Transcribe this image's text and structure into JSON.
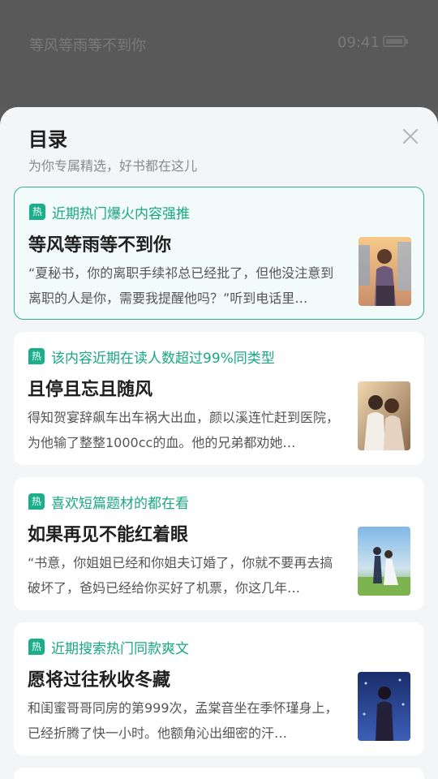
{
  "status": {
    "book_title": "等风等雨等不到你",
    "time": "09:41"
  },
  "sheet": {
    "title": "目录",
    "subtitle": "为你专属精选，好书都在这儿"
  },
  "hot_badge": "热",
  "books": [
    {
      "tag": "近期热门爆火内容强推",
      "title": "等风等雨等不到你",
      "desc": "“夏秘书，你的离职手续祁总已经批了，但他没注意到离职的人是你，需要我提醒他吗？”听到电话里…"
    },
    {
      "tag": "该内容近期在读人数超过99%同类型",
      "title": "且停且忘且随风",
      "desc": "得知贺宴辞飙车出车祸大出血，颜以溪连忙赶到医院，为他输了整整1000cc的血。他的兄弟都劝她…"
    },
    {
      "tag": "喜欢短篇题材的都在看",
      "title": "如果再见不能红着眼",
      "desc": "“书意，你姐姐已经和你姐夫订婚了，你就不要再去搞破坏了，爸妈已经给你买好了机票，你这几年…"
    },
    {
      "tag": "近期搜索热门同款爽文",
      "title": "愿将过往秋收冬藏",
      "desc": "和闺蜜哥哥同房的第999次，孟棠音坐在季怀瑾身上，已经折腾了快一小时。他额角沁出细密的汗…"
    }
  ],
  "colors": {
    "accent": "#1aae8a",
    "tag_text": "#19a882",
    "active_border": "#29b394"
  }
}
